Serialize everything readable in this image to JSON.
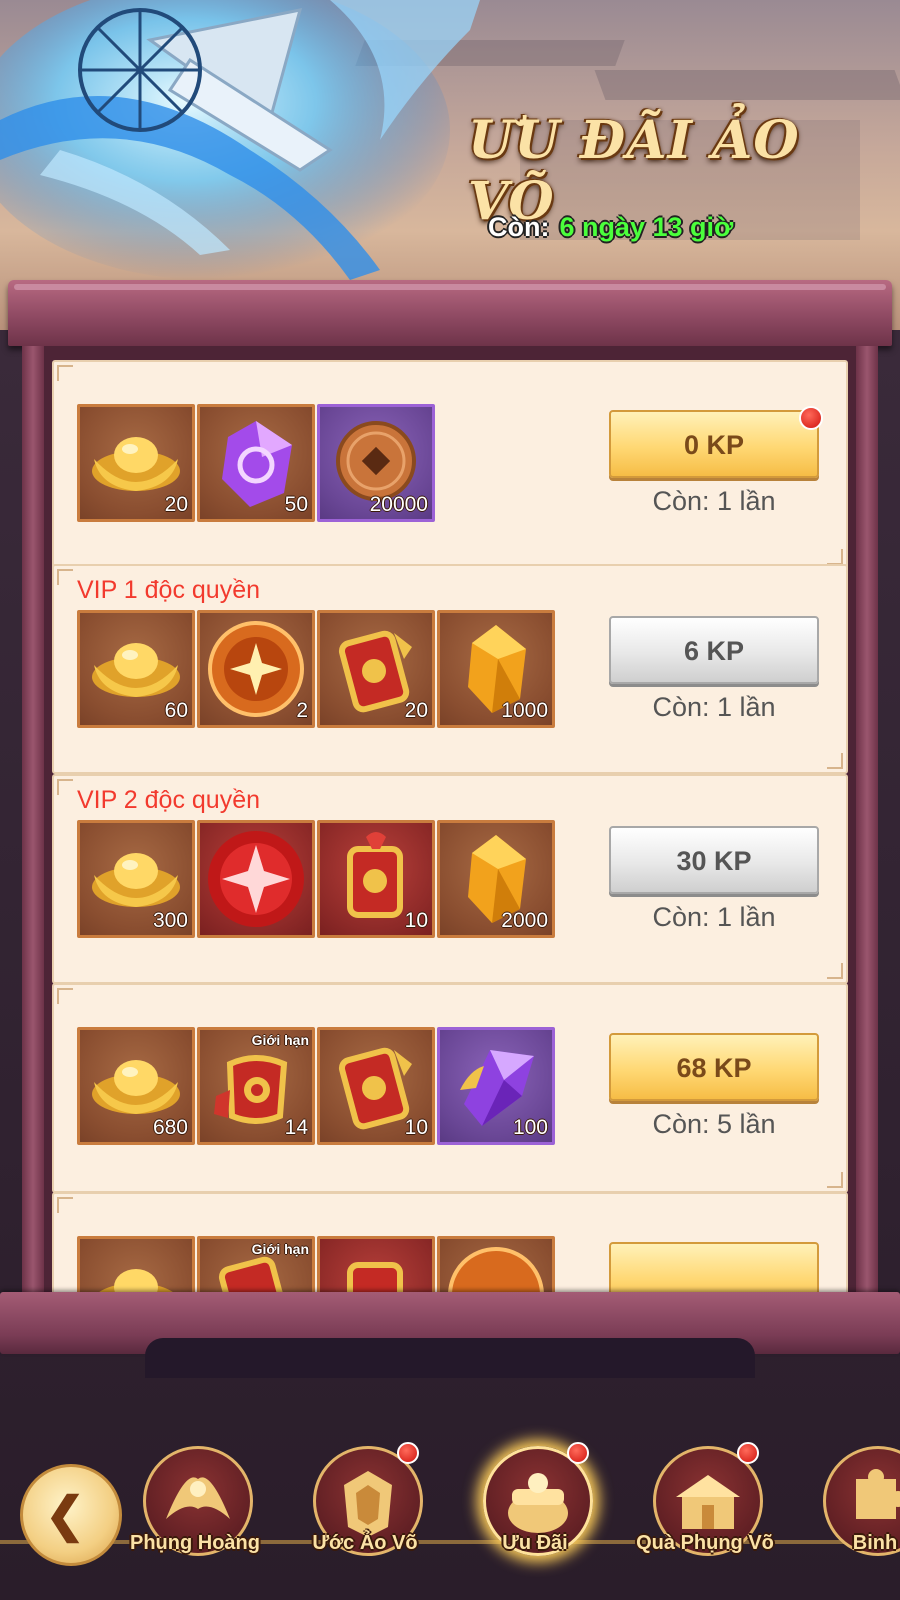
{
  "event": {
    "title": "ƯU ĐÃI ẢO VÕ",
    "remaining_label": "Còn:",
    "remaining_value": "6 ngày 13 giờ"
  },
  "offers": [
    {
      "vip_label": "",
      "items": [
        {
          "icon": "gold-ingot-icon",
          "qty": "20"
        },
        {
          "icon": "purple-gem-icon",
          "qty": "50"
        },
        {
          "icon": "copper-coin-icon",
          "qty": "20000"
        }
      ],
      "price": "0 KP",
      "remaining": "Còn: 1 lần"
    },
    {
      "vip_label": "VIP 1 độc quyền",
      "items": [
        {
          "icon": "gold-ingot-icon",
          "qty": "60"
        },
        {
          "icon": "orange-orb-icon",
          "qty": "2"
        },
        {
          "icon": "token-tablet-icon",
          "qty": "20"
        },
        {
          "icon": "amber-crystal-icon",
          "qty": "1000"
        }
      ],
      "price": "6 KP",
      "remaining": "Còn: 1 lần"
    },
    {
      "vip_label": "VIP 2 độc quyền",
      "items": [
        {
          "icon": "gold-ingot-icon",
          "qty": "300"
        },
        {
          "icon": "red-orb-icon",
          "qty": ""
        },
        {
          "icon": "red-talisman-icon",
          "qty": "10"
        },
        {
          "icon": "amber-crystal-icon",
          "qty": "2000"
        }
      ],
      "price": "30 KP",
      "remaining": "Còn: 1 lần"
    },
    {
      "vip_label": "",
      "items": [
        {
          "icon": "gold-ingot-icon",
          "qty": "680"
        },
        {
          "icon": "scroll-badge-icon",
          "qty": "14",
          "tag": "Giới hạn"
        },
        {
          "icon": "token-tablet-icon",
          "qty": "10"
        },
        {
          "icon": "violet-crystal-icon",
          "qty": "100"
        }
      ],
      "price": "68 KP",
      "remaining": "Còn: 5 lần"
    },
    {
      "vip_label": "",
      "items": [
        {
          "icon": "gold-ingot-icon",
          "qty": ""
        },
        {
          "icon": "token-tablet-icon",
          "qty": "",
          "tag": "Giới hạn"
        },
        {
          "icon": "red-talisman-icon",
          "qty": ""
        },
        {
          "icon": "orange-orb-icon",
          "qty": ""
        }
      ],
      "price": "",
      "remaining": ""
    }
  ],
  "nav": {
    "back_icon": "back-arrow-icon",
    "tabs": [
      {
        "label": "Phụng Hoàng",
        "icon": "phoenix-emblem-icon"
      },
      {
        "label": "Ước Ảo Võ",
        "icon": "armor-emblem-icon"
      },
      {
        "label": "Ưu Đãi",
        "icon": "treasure-pot-icon"
      },
      {
        "label": "Quà Phụng Võ",
        "icon": "gift-building-icon"
      },
      {
        "label": "Binh",
        "icon": "puzzle-emblem-icon"
      }
    ]
  },
  "colors": {
    "remaining_value": "#4bff3c",
    "vip_label": "#f23a2e",
    "button_active": "#ffd874",
    "button_inactive": "#e8e8e8",
    "card_bg": "#fcefe0",
    "frame": "#8f4a63"
  }
}
